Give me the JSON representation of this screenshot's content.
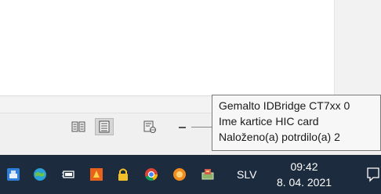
{
  "tooltip": {
    "line1": "Gemalto IDBridge CT7xx 0",
    "line2": "Ime kartice HIC card",
    "line3": "Naloženo(a) potrdilo(a) 2"
  },
  "statusbar": {
    "views": [
      {
        "icon": "read-mode-icon",
        "active": false
      },
      {
        "icon": "print-layout-icon",
        "active": true
      },
      {
        "icon": "web-layout-icon",
        "active": false
      }
    ],
    "zoom_minus_icon": "zoom-out-icon"
  },
  "taskbar": {
    "tray_icons": [
      "network-drive-icon",
      "globe-sync-icon",
      "battery-plug-icon",
      "office-app-icon",
      "lock-icon",
      "chrome-icon",
      "orange-app-icon",
      "smart-card-reader-icon"
    ],
    "language": "SLV",
    "time": "09:42",
    "date": "8. 04. 2021",
    "notification_icon": "notification-icon"
  },
  "colors": {
    "taskbar_bg": "#1c2b3e",
    "tooltip_bg": "#f7f7f7",
    "statusbar_bg": "#f0f0f0"
  }
}
